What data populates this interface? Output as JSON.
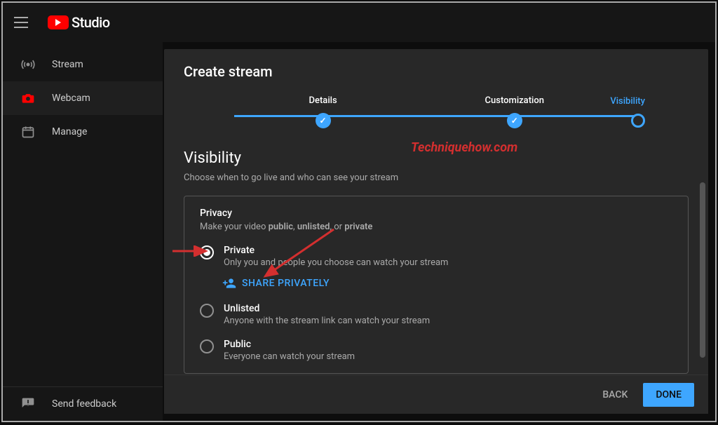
{
  "app": {
    "name": "Studio"
  },
  "sidebar": {
    "items": [
      {
        "label": "Stream",
        "icon": "broadcast-icon"
      },
      {
        "label": "Webcam",
        "icon": "camera-icon"
      },
      {
        "label": "Manage",
        "icon": "calendar-icon"
      }
    ],
    "footer": {
      "label": "Send feedback",
      "icon": "feedback-icon"
    }
  },
  "panel": {
    "title": "Create stream",
    "steps": [
      {
        "label": "Details"
      },
      {
        "label": "Customization"
      },
      {
        "label": "Visibility"
      }
    ],
    "section": {
      "title": "Visibility",
      "subtitle": "Choose when to go live and who can see your stream"
    },
    "privacy": {
      "heading": "Privacy",
      "sub_prefix": "Make your video ",
      "sub_b1": "public",
      "sub_sep1": ", ",
      "sub_b2": "unlisted",
      "sub_sep2": ", or ",
      "sub_b3": "private",
      "options": [
        {
          "label": "Private",
          "desc": "Only you and people you choose can watch your stream",
          "selected": true
        },
        {
          "label": "Unlisted",
          "desc": "Anyone with the stream link can watch your stream",
          "selected": false
        },
        {
          "label": "Public",
          "desc": "Everyone can watch your stream",
          "selected": false
        }
      ],
      "share_label": "SHARE PRIVATELY"
    },
    "footer": {
      "back": "BACK",
      "done": "DONE"
    }
  },
  "watermark": "Techniquehow.com"
}
